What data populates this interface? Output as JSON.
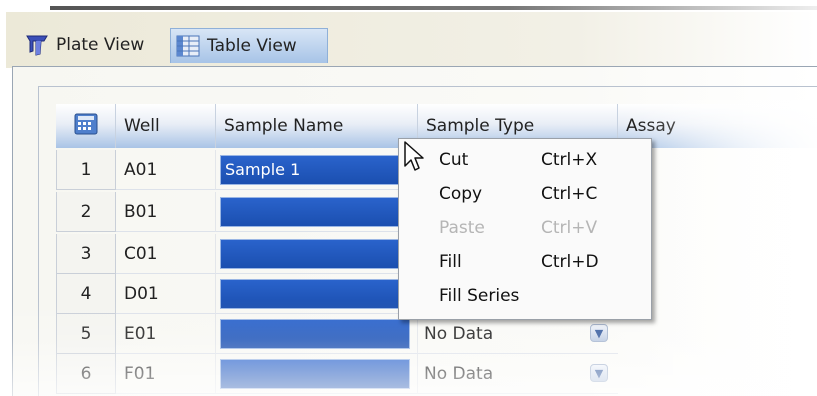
{
  "tabs": [
    {
      "label": "Plate View",
      "icon": "plate-icon"
    },
    {
      "label": "Table View",
      "icon": "table-grid-icon"
    }
  ],
  "table": {
    "columns": [
      "Well",
      "Sample Name",
      "Sample Type",
      "Assay"
    ],
    "rows": [
      {
        "num": "1",
        "well": "A01",
        "sample_name": "Sample 1",
        "sample_type": ""
      },
      {
        "num": "2",
        "well": "B01",
        "sample_name": "",
        "sample_type": ""
      },
      {
        "num": "3",
        "well": "C01",
        "sample_name": "",
        "sample_type": ""
      },
      {
        "num": "4",
        "well": "D01",
        "sample_name": "",
        "sample_type": ""
      },
      {
        "num": "5",
        "well": "E01",
        "sample_name": "",
        "sample_type": "No Data"
      },
      {
        "num": "6",
        "well": "F01",
        "sample_name": "",
        "sample_type": "No Data"
      }
    ]
  },
  "context_menu": {
    "items": [
      {
        "label": "Cut",
        "shortcut": "Ctrl+X",
        "enabled": true
      },
      {
        "label": "Copy",
        "shortcut": "Ctrl+C",
        "enabled": true
      },
      {
        "label": "Paste",
        "shortcut": "Ctrl+V",
        "enabled": false
      },
      {
        "label": "Fill",
        "shortcut": "Ctrl+D",
        "enabled": true
      },
      {
        "label": "Fill Series",
        "shortcut": "",
        "enabled": true
      }
    ]
  },
  "colors": {
    "selection": "#2a63cc",
    "header_gradient_end": "#a9c4e6"
  }
}
